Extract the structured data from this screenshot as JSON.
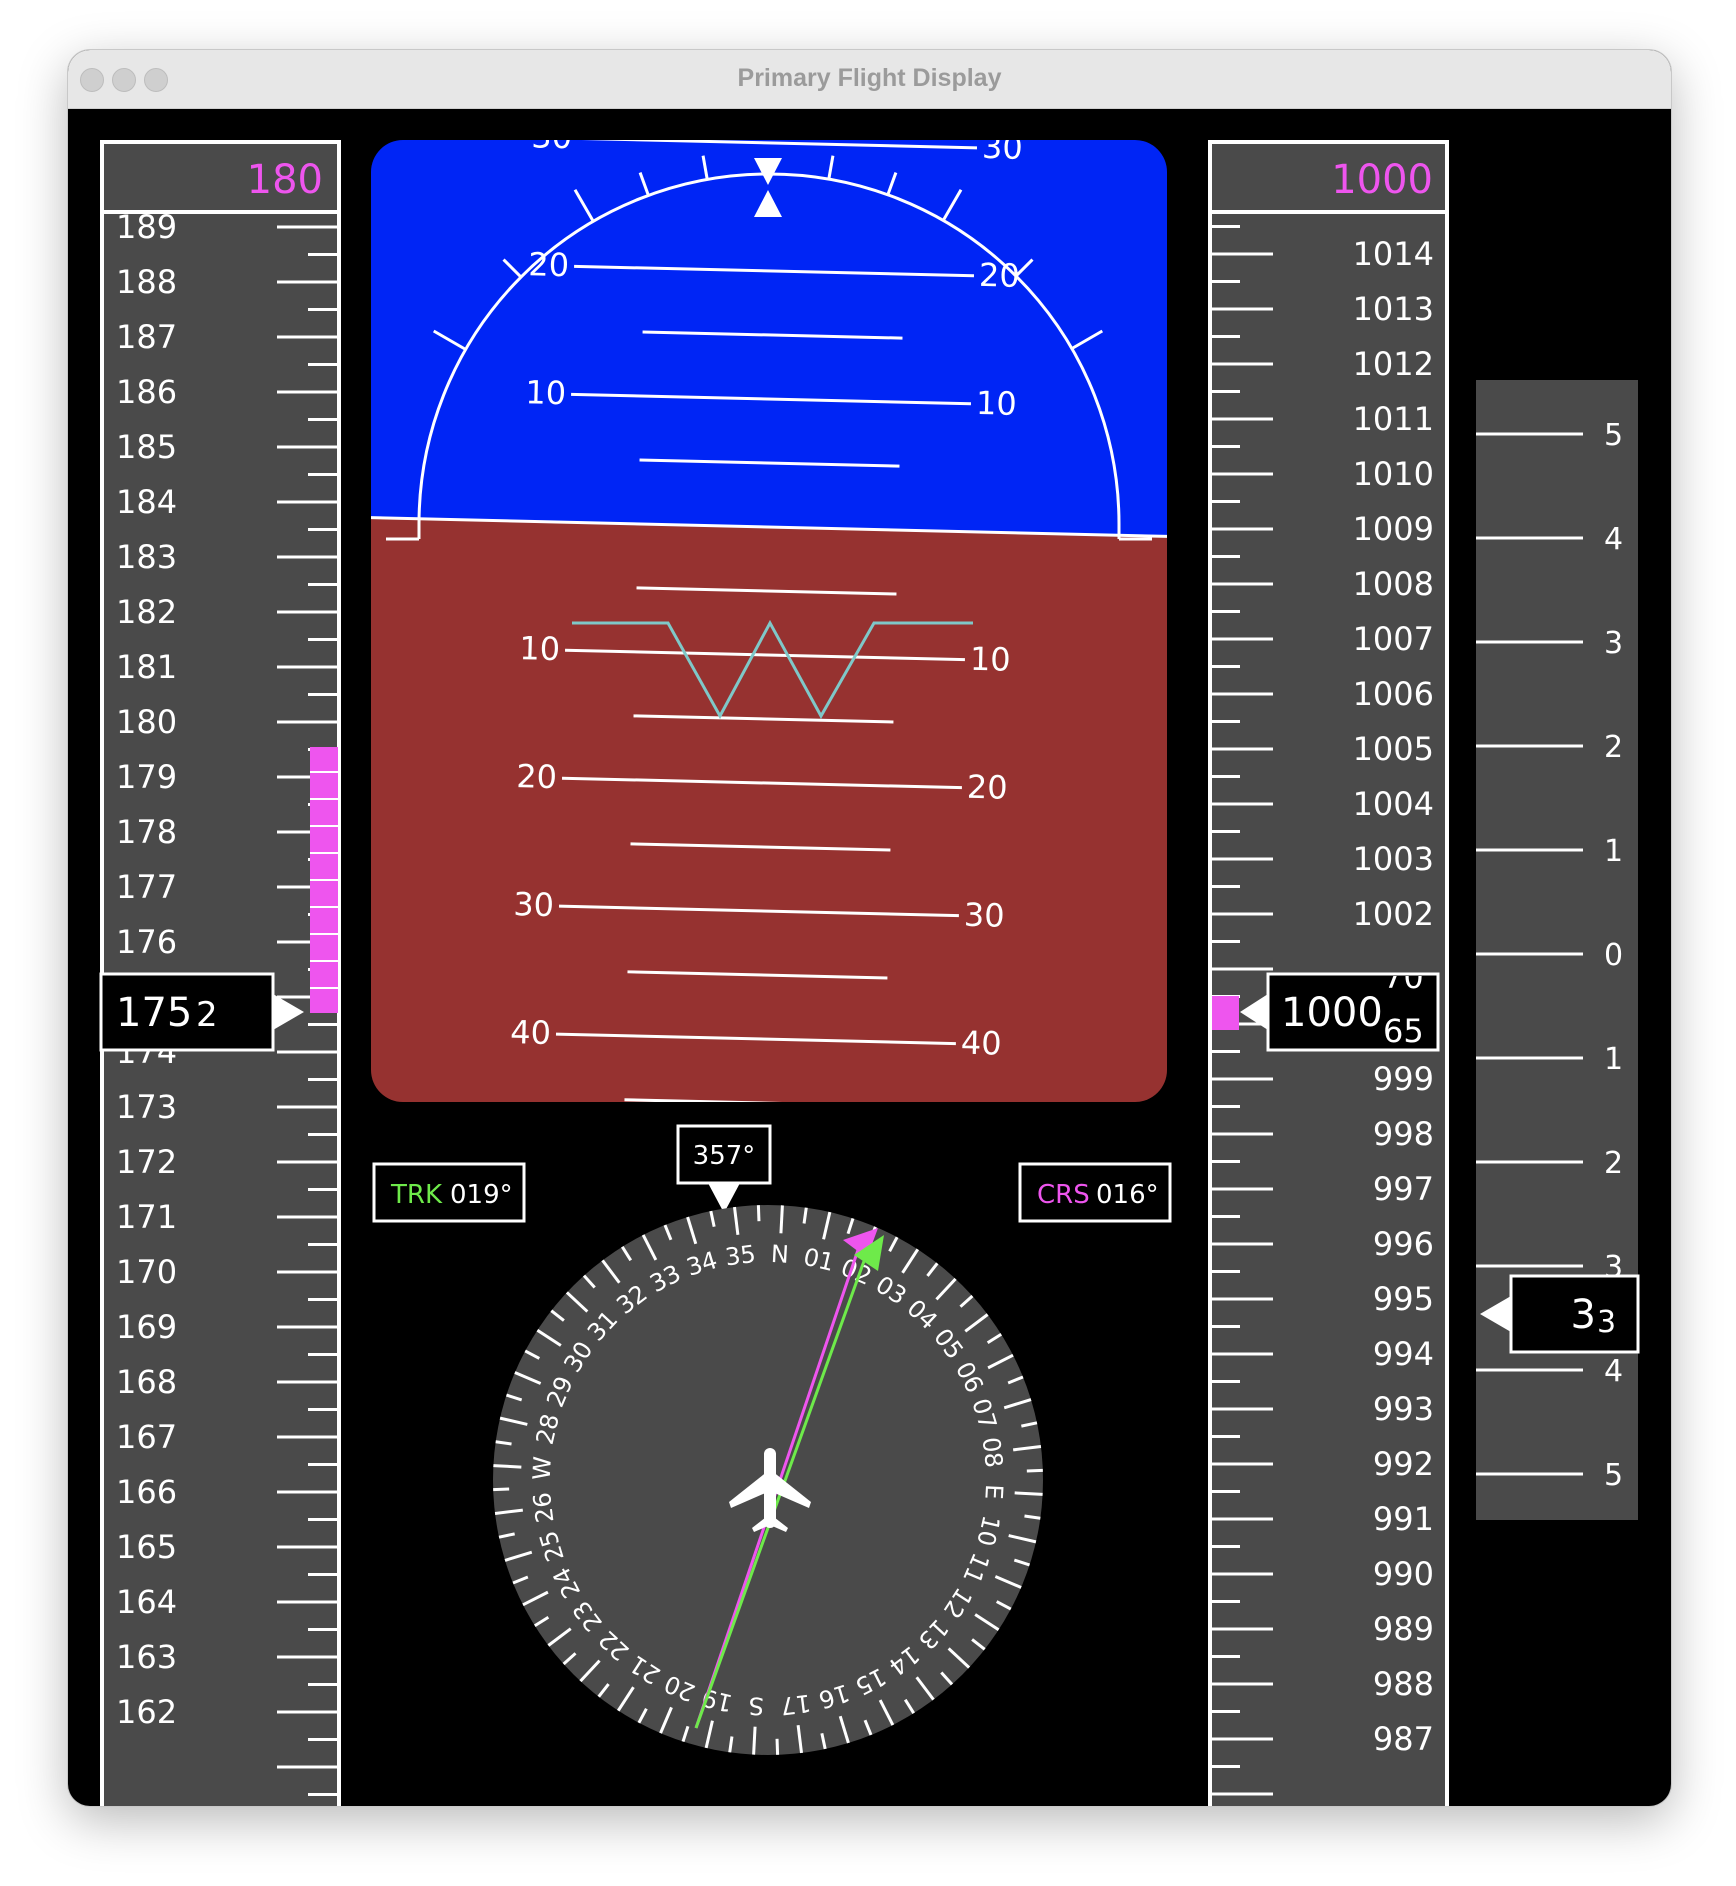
{
  "window": {
    "title": "Primary Flight Display"
  },
  "colors": {
    "sky": "#0025f5",
    "ground": "#963230",
    "tape": "#4a4a4a",
    "magenta": "#ee55ee",
    "green": "#6eea4a",
    "cyan": "#7fc8c8",
    "white": "#ffffff"
  },
  "speed": {
    "selected": "180",
    "labels_above": [
      "189",
      "188",
      "187",
      "186",
      "185",
      "184",
      "183",
      "182",
      "181",
      "180",
      "179",
      "178",
      "177",
      "176"
    ],
    "labels_below": [
      "174",
      "173",
      "172",
      "171",
      "170",
      "169",
      "168",
      "167",
      "166",
      "165",
      "164",
      "163",
      "162"
    ],
    "readout_main": "175",
    "readout_roll": "2",
    "trend_top_value": 180,
    "current_value": 175.2
  },
  "altitude": {
    "selected": "1000",
    "labels_above": [
      "1014",
      "1013",
      "1012",
      "1011",
      "1010",
      "1009",
      "1008",
      "1007",
      "1006",
      "1005",
      "1004",
      "1003",
      "1002"
    ],
    "labels_below": [
      "1000",
      "999",
      "998",
      "997",
      "996",
      "995",
      "994",
      "993",
      "992",
      "991",
      "990",
      "989",
      "988",
      "987"
    ],
    "readout_main": "1000",
    "readout_roll_top": "70",
    "readout_roll_bottom": "65"
  },
  "vertical_speed": {
    "labels_up": [
      "5",
      "4",
      "3",
      "2",
      "1"
    ],
    "zero": "0",
    "labels_down": [
      "1",
      "2",
      "3",
      "4",
      "5"
    ],
    "readout_main": "3",
    "readout_sub": "3"
  },
  "attitude": {
    "pitch_labels_up": [
      "10",
      "20",
      "30"
    ],
    "pitch_labels_down": [
      "10",
      "20",
      "30",
      "40"
    ]
  },
  "heading": {
    "current": "357°",
    "track_label": "TRK",
    "track_value": "019°",
    "course_label": "CRS",
    "course_value": "016°",
    "rose_labels": [
      "N",
      "01",
      "02",
      "03",
      "04",
      "05",
      "06",
      "07",
      "08",
      "E",
      "10",
      "11",
      "12",
      "13",
      "14",
      "15",
      "16",
      "17",
      "S",
      "19",
      "20",
      "21",
      "22",
      "23",
      "24",
      "25",
      "26",
      "W",
      "28",
      "29",
      "30",
      "31",
      "32",
      "33",
      "34",
      "35"
    ]
  }
}
